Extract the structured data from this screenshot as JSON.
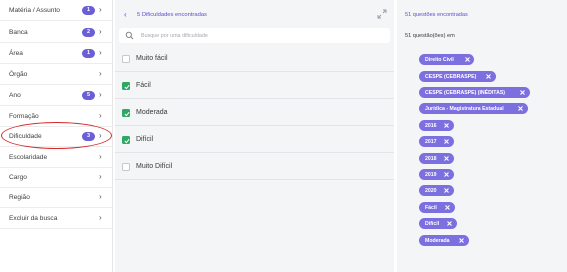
{
  "sidebar": {
    "items": [
      {
        "label": "Matéria / Assunto",
        "badge": "1"
      },
      {
        "label": "Banca",
        "badge": "2"
      },
      {
        "label": "Área",
        "badge": "1"
      },
      {
        "label": "Órgão",
        "badge": ""
      },
      {
        "label": "Ano",
        "badge": "5"
      },
      {
        "label": "Formação",
        "badge": ""
      },
      {
        "label": "Dificuldade",
        "badge": "3"
      },
      {
        "label": "Escolaridade",
        "badge": ""
      },
      {
        "label": "Cargo",
        "badge": ""
      },
      {
        "label": "Região",
        "badge": ""
      },
      {
        "label": "Excluir da busca",
        "badge": ""
      }
    ],
    "chevron": "›"
  },
  "difficulty_panel": {
    "back_icon": "‹",
    "count_text": "5 Dificuldades encontradas",
    "search_placeholder": "Busque por uma dificuldade",
    "options": [
      {
        "label": "Muito fácil",
        "checked": false
      },
      {
        "label": "Fácil",
        "checked": true
      },
      {
        "label": "Moderada",
        "checked": true
      },
      {
        "label": "Difícil",
        "checked": true
      },
      {
        "label": "Muito Difícil",
        "checked": false
      }
    ]
  },
  "results": {
    "title": "51 questões encontradas",
    "count_text": "51 questão(ões) em",
    "chips": [
      "Direito Civil",
      "CESPE (CEBRASPE)",
      "CESPE (CEBRASPE) (INÉDITAS)",
      "Jurídica - Magistratura Estadual",
      "2016",
      "2017",
      "2018",
      "2019",
      "2020",
      "Fácil",
      "Difícil",
      "Moderada"
    ]
  },
  "colors": {
    "accent": "#6b5fd6",
    "chip": "#7c6fe0",
    "check": "#2fa866",
    "annotation": "#d52a2a",
    "panel_bg": "#f4f5f7"
  },
  "icons": {
    "back": "chevron-left-icon",
    "expand": "expand-arrows-icon",
    "search": "search-icon",
    "chip_remove": "close-icon",
    "item_chevron": "chevron-right-icon"
  }
}
